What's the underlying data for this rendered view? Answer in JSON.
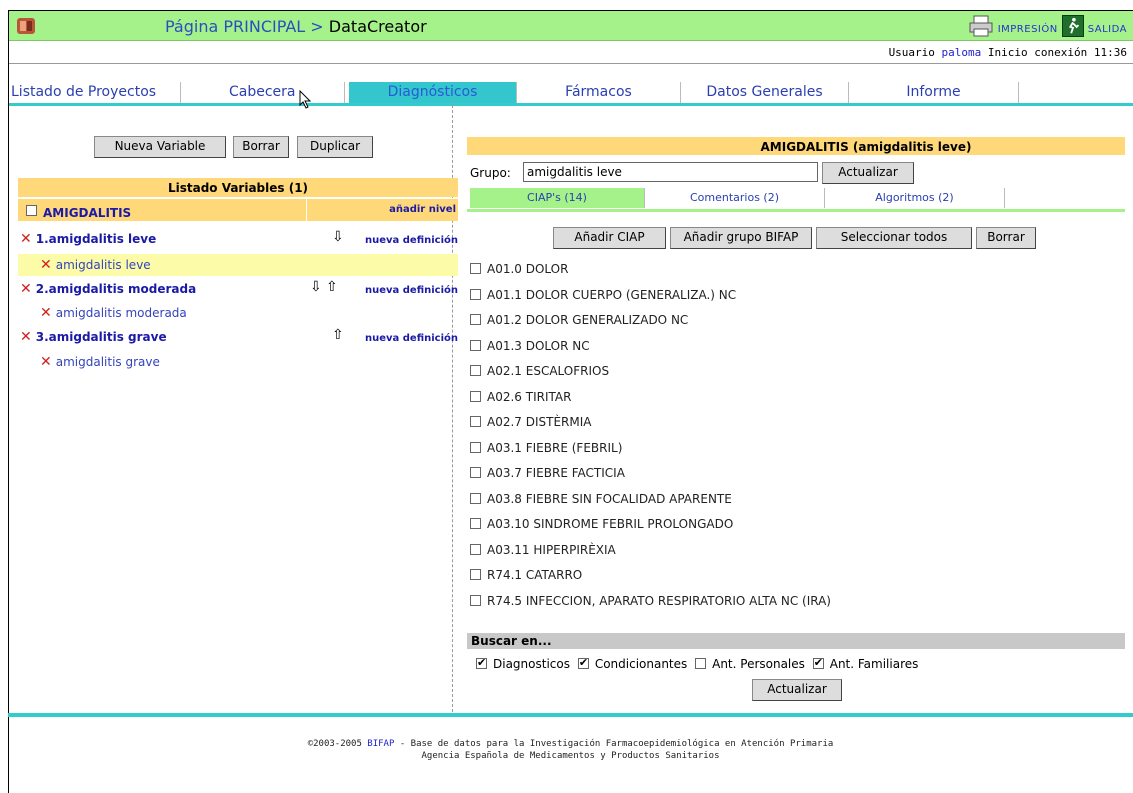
{
  "header": {
    "breadcrumb_home": "Página PRINCIPAL",
    "breadcrumb_sep": ">",
    "app_name": "DataCreator",
    "print_label": "IMPRESIÓN",
    "exit_label": "SALIDA"
  },
  "userbar": {
    "prefix": "Usuario",
    "user": "paloma",
    "session": "Inicio conexión 11:36"
  },
  "tabs": [
    {
      "label": "Listado de Proyectos"
    },
    {
      "label": "Cabecera"
    },
    {
      "label": "Diagnósticos",
      "active": true
    },
    {
      "label": "Fármacos"
    },
    {
      "label": "Datos Generales"
    },
    {
      "label": "Informe"
    }
  ],
  "left": {
    "buttons": {
      "new": "Nueva Variable",
      "delete": "Borrar",
      "duplicate": "Duplicar"
    },
    "list_title": "Listado Variables (1)",
    "group": {
      "name": "AMIGDALITIS",
      "action": "añadir nivel"
    },
    "variables": [
      {
        "name": "1.amigdalitis leve",
        "action": "nueva definición",
        "definition": "amigdalitis leve"
      },
      {
        "name": "2.amigdalitis moderada",
        "action": "nueva definición",
        "definition": "amigdalitis moderada"
      },
      {
        "name": "3.amigdalitis grave",
        "action": "nueva definición",
        "definition": "amigdalitis grave"
      }
    ]
  },
  "right": {
    "title": "AMIGDALITIS (amigdalitis leve)",
    "group_label": "Grupo:",
    "group_value": "amigdalitis leve",
    "update_label": "Actualizar",
    "subtabs": [
      "CIAP's (14)",
      "Comentarios (2)",
      "Algoritmos (2)"
    ],
    "actions": {
      "add_ciap": "Añadir CIAP",
      "add_group": "Añadir grupo BIFAP",
      "select_all": "Seleccionar todos",
      "delete": "Borrar"
    },
    "ciaps": [
      "A01.0 DOLOR",
      "A01.1 DOLOR CUERPO (GENERALIZA.) NC",
      "A01.2 DOLOR GENERALIZADO NC",
      "A01.3 DOLOR NC",
      "A02.1 ESCALOFRIOS",
      "A02.6 TIRITAR",
      "A02.7 DISTÈRMIA",
      "A03.1 FIEBRE (FEBRIL)",
      "A03.7 FIEBRE FACTICIA",
      "A03.8 FIEBRE SIN FOCALIDAD APARENTE",
      "A03.10 SINDROME FEBRIL PROLONGADO",
      "A03.11 HIPERPIRÈXIA",
      "R74.1 CATARRO",
      "R74.5 INFECCION, APARATO RESPIRATORIO ALTA NC (IRA)"
    ],
    "search": {
      "title": "Buscar en...",
      "options": [
        {
          "label": "Diagnosticos",
          "checked": true
        },
        {
          "label": "Condicionantes",
          "checked": true
        },
        {
          "label": "Ant. Personales",
          "checked": false
        },
        {
          "label": "Ant. Familiares",
          "checked": true
        }
      ],
      "update_label": "Actualizar"
    }
  },
  "footer": {
    "line1_prefix": "©2003-2005",
    "brand": "BIFAP",
    "line1_rest": "- Base de datos para la Investigación Farmacoepidemiológica en Atención Primaria",
    "line2": "Agencia Española de Medicamentos y Productos Sanitarios"
  },
  "colors": {
    "header_bg": "#a6f28a",
    "tab_active": "#33c6cc",
    "section_head": "#ffd87a",
    "accent_line": "#33cccc"
  }
}
